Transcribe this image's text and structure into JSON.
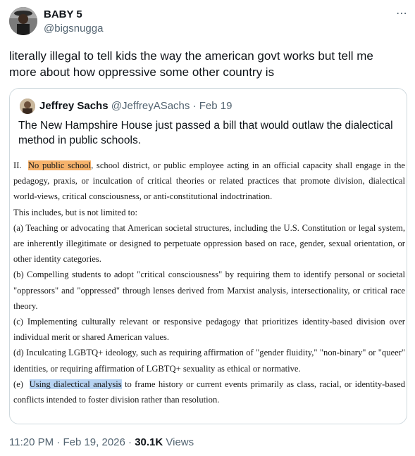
{
  "author": {
    "name": "BABY 5",
    "handle": "@bigsnugga"
  },
  "more_icon": "⋯",
  "tweet_text": "literally illegal to tell kids the way the american govt works but tell me more about how oppressive some other country is",
  "quote": {
    "name": "Jeffrey Sachs",
    "handle": "@JeffreyASachs",
    "separator": "·",
    "date": "Feb 19",
    "text": "The New Hampshire House just passed a bill that would outlaw the dialectical method in public schools.",
    "document": {
      "p1_prefix": "II.",
      "p1_highlight": "No public school",
      "p1_rest": ", school district, or public employee acting in an official capacity shall engage in the pedagogy, praxis, or inculcation of critical theories or related practices that promote division, dialectical world-views, critical consciousness, or anti-constitutional indoctrination.",
      "p2": "This includes, but is not limited to:",
      "a": "(a)  Teaching or advocating that American societal structures, including the U.S. Constitution or legal system, are inherently illegitimate or designed to perpetuate oppression based on race, gender, sexual orientation, or other identity categories.",
      "b": "(b)  Compelling students to adopt \"critical consciousness\" by requiring them to identify personal or societal \"oppressors\" and \"oppressed\" through lenses derived from Marxist analysis, intersectionality, or critical race theory.",
      "c": "(c)  Implementing culturally relevant or responsive pedagogy that prioritizes identity-based division over individual merit or shared American values.",
      "d": "(d)  Inculcating LGBTQ+ ideology, such as requiring affirmation of \"gender fluidity,\" \"non-binary\" or \"queer\" identities, or requiring affirmation of LGBTQ+ sexuality as ethical or normative.",
      "e_prefix": "(e)",
      "e_highlight": "Using dialectical analysis",
      "e_rest": " to frame history or current events primarily as class, racial, or identity-based conflicts intended to foster division rather than resolution."
    }
  },
  "footer": {
    "time": "11:20 PM",
    "sep1": "·",
    "date": "Feb 19, 2026",
    "sep2": "·",
    "views_count": "30.1K",
    "views_label": "Views"
  },
  "colors": {
    "highlight_orange": "#f6b26b",
    "highlight_blue": "#b7d3f2",
    "border": "#cfd9de",
    "muted": "#536471"
  }
}
